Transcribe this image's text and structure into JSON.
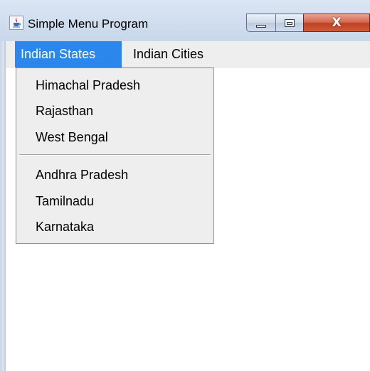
{
  "window": {
    "title": "Simple Menu Program",
    "icon": "java-cup-icon",
    "controls": {
      "minimize": "minimize-icon",
      "maximize": "maximize-icon",
      "close_glyph": "X"
    }
  },
  "menubar": {
    "menus": [
      {
        "label": "Indian States",
        "state": "open"
      },
      {
        "label": "Indian Cities",
        "state": "closed"
      }
    ]
  },
  "dropdown": {
    "group1": [
      "Himachal Pradesh",
      "Rajasthan",
      "West Bengal"
    ],
    "group2": [
      "Andhra Pradesh",
      "Tamilnadu",
      "Karnataka"
    ]
  },
  "colors": {
    "menu_highlight": "#2b87ec",
    "menu_background": "#eeeeee",
    "close_button": "#c1401f"
  }
}
